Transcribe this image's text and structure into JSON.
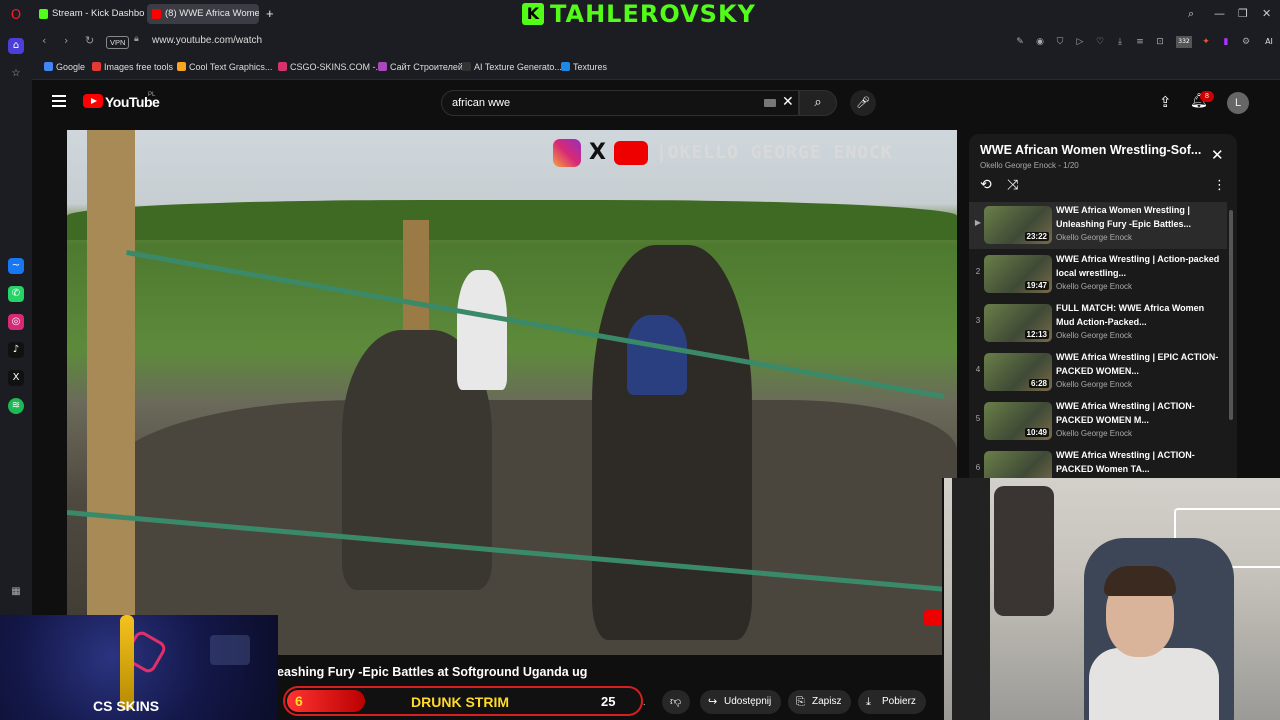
{
  "browser": {
    "tabs": [
      {
        "label": "Stream - Kick Dashboard",
        "icon": "kick-icon",
        "color": "#53fc18"
      },
      {
        "label": "(8) WWE Africa Wome",
        "icon": "youtube-icon",
        "color": "#ff0000"
      }
    ],
    "new_tab_label": "+",
    "brand_letter": "K",
    "brand_name": "TAHLEROVSKY",
    "url": "www.youtube.com/watch",
    "vpn_label": "VPN",
    "ext_badge": "332",
    "ai_label": "AI",
    "bookmarks": [
      {
        "label": "Google",
        "color": "#4285f4"
      },
      {
        "label": "Images free tools",
        "color": "#e53935"
      },
      {
        "label": "Cool Text Graphics...",
        "color": "#f5a623"
      },
      {
        "label": "CSGO-SKINS.COM -...",
        "color": "#d6336c"
      },
      {
        "label": "Сайт Строителей",
        "color": "#ab47bc"
      },
      {
        "label": "AI Texture Generato...",
        "color": "#333333"
      },
      {
        "label": "Textures",
        "color": "#1e88e5"
      }
    ]
  },
  "youtube": {
    "logo_text": "YouTube",
    "country": "PL",
    "search_value": "african wwe",
    "notifications": "8",
    "avatar_letter": "L",
    "video_watermark": "|OKELLO GEORGE ENOCK",
    "video_title": "eashing Fury -Epic Battles at Softground Uganda ug",
    "actions": {
      "share": "Udostępnij",
      "save": "Zapisz",
      "download": "Pobierz",
      "views_partial": "ys."
    }
  },
  "playlist": {
    "title": "WWE African Women Wrestling-Sof...",
    "owner": "Okello George Enock",
    "position": "1/20",
    "items": [
      {
        "index": "▶",
        "title": "WWE Africa Women Wrestling | Unleashing Fury -Epic Battles...",
        "channel": "Okello George Enock",
        "duration": "23:22"
      },
      {
        "index": "2",
        "title": "WWE Africa Wrestling | Action-packed local wrestling...",
        "channel": "Okello George Enock",
        "duration": "19:47"
      },
      {
        "index": "3",
        "title": "FULL MATCH: WWE Africa Women Mud Action-Packed...",
        "channel": "Okello George Enock",
        "duration": "12:13"
      },
      {
        "index": "4",
        "title": "WWE Africa Wrestling | EPIC ACTION-PACKED WOMEN...",
        "channel": "Okello George Enock",
        "duration": "6:28"
      },
      {
        "index": "5",
        "title": "WWE Africa Wrestling | ACTION-PACKED WOMEN M...",
        "channel": "Okello George Enock",
        "duration": "10:49"
      },
      {
        "index": "6",
        "title": "WWE Africa Wrestling | ACTION-PACKED Women TA...",
        "channel": "",
        "duration": ""
      }
    ]
  },
  "overlay": {
    "drunk_count": "6",
    "drunk_label": "DRUNK STRIM",
    "likes": "25",
    "cs_brand": "CS SKINS"
  }
}
